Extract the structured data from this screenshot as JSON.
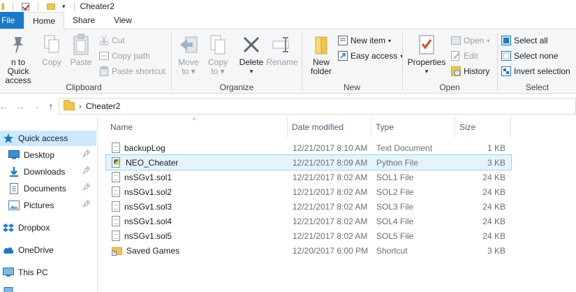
{
  "window": {
    "title": "Cheater2"
  },
  "tabs": [
    {
      "label": "File"
    },
    {
      "label": "Home"
    },
    {
      "label": "Share"
    },
    {
      "label": "View"
    }
  ],
  "ribbon": {
    "clipboard": {
      "label": "Clipboard",
      "pin_label_1": "n to Quick",
      "pin_label_2": "access",
      "copy": "Copy",
      "paste": "Paste",
      "cut": "Cut",
      "copy_path": "Copy path",
      "paste_shortcut": "Paste shortcut"
    },
    "organize": {
      "label": "Organize",
      "move_to_1": "Move",
      "move_to_2": "to",
      "copy_to_1": "Copy",
      "copy_to_2": "to",
      "delete": "Delete",
      "rename": "Rename"
    },
    "new": {
      "label": "New",
      "new_folder_1": "New",
      "new_folder_2": "folder",
      "new_item": "New item",
      "easy_access": "Easy access"
    },
    "open": {
      "label": "Open",
      "properties": "Properties",
      "open": "Open",
      "edit": "Edit",
      "history": "History"
    },
    "select": {
      "label": "Select",
      "select_all": "Select all",
      "select_none": "Select none",
      "invert_selection": "Invert selection"
    }
  },
  "address": {
    "breadcrumb_sep": "›",
    "path": "Cheater2"
  },
  "nav": {
    "items": [
      {
        "label": "Quick access",
        "icon": "star-icon",
        "selected": true
      },
      {
        "label": "Desktop",
        "icon": "desktop-icon",
        "pinned": true
      },
      {
        "label": "Downloads",
        "icon": "download-icon",
        "pinned": true
      },
      {
        "label": "Documents",
        "icon": "documents-icon",
        "pinned": true
      },
      {
        "label": "Pictures",
        "icon": "pictures-icon",
        "pinned": true
      },
      {
        "label": "Dropbox",
        "icon": "dropbox-icon"
      },
      {
        "label": "OneDrive",
        "icon": "cloud-icon"
      },
      {
        "label": "This PC",
        "icon": "computer-icon"
      }
    ]
  },
  "columns": {
    "name": "Name",
    "date": "Date modified",
    "type": "Type",
    "size": "Size"
  },
  "files": [
    {
      "name": "backupLog",
      "date": "12/21/2017 8:10 AM",
      "type": "Text Document",
      "size": "1 KB",
      "icon": "text-file-icon"
    },
    {
      "name": "NEO_Cheater",
      "date": "12/21/2017 8:09 AM",
      "type": "Python File",
      "size": "3 KB",
      "icon": "python-file-icon",
      "hover": true
    },
    {
      "name": "nsSGv1.sol1",
      "date": "12/21/2017 8:02 AM",
      "type": "SOL1 File",
      "size": "24 KB",
      "icon": "file-icon"
    },
    {
      "name": "nsSGv1.sol2",
      "date": "12/21/2017 8:02 AM",
      "type": "SOL2 File",
      "size": "24 KB",
      "icon": "file-icon"
    },
    {
      "name": "nsSGv1.sol3",
      "date": "12/21/2017 8:02 AM",
      "type": "SOL3 File",
      "size": "24 KB",
      "icon": "file-icon"
    },
    {
      "name": "nsSGv1.sol4",
      "date": "12/21/2017 8:02 AM",
      "type": "SOL4 File",
      "size": "24 KB",
      "icon": "file-icon"
    },
    {
      "name": "nsSGv1.sol5",
      "date": "12/21/2017 8:02 AM",
      "type": "SOL5 File",
      "size": "24 KB",
      "icon": "file-icon"
    },
    {
      "name": "Saved Games",
      "date": "12/20/2017 6:00 PM",
      "type": "Shortcut",
      "size": "3 KB",
      "icon": "shortcut-icon"
    }
  ]
}
